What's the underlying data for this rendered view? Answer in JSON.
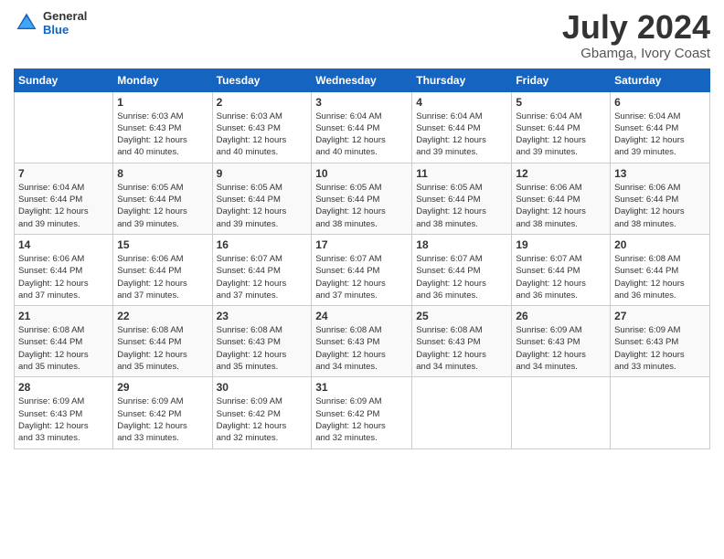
{
  "header": {
    "logo_line1": "General",
    "logo_line2": "Blue",
    "main_title": "July 2024",
    "subtitle": "Gbamga, Ivory Coast"
  },
  "calendar": {
    "days_of_week": [
      "Sunday",
      "Monday",
      "Tuesday",
      "Wednesday",
      "Thursday",
      "Friday",
      "Saturday"
    ],
    "weeks": [
      [
        {
          "day": "",
          "info": ""
        },
        {
          "day": "1",
          "info": "Sunrise: 6:03 AM\nSunset: 6:43 PM\nDaylight: 12 hours\nand 40 minutes."
        },
        {
          "day": "2",
          "info": "Sunrise: 6:03 AM\nSunset: 6:43 PM\nDaylight: 12 hours\nand 40 minutes."
        },
        {
          "day": "3",
          "info": "Sunrise: 6:04 AM\nSunset: 6:44 PM\nDaylight: 12 hours\nand 40 minutes."
        },
        {
          "day": "4",
          "info": "Sunrise: 6:04 AM\nSunset: 6:44 PM\nDaylight: 12 hours\nand 39 minutes."
        },
        {
          "day": "5",
          "info": "Sunrise: 6:04 AM\nSunset: 6:44 PM\nDaylight: 12 hours\nand 39 minutes."
        },
        {
          "day": "6",
          "info": "Sunrise: 6:04 AM\nSunset: 6:44 PM\nDaylight: 12 hours\nand 39 minutes."
        }
      ],
      [
        {
          "day": "7",
          "info": "Sunrise: 6:04 AM\nSunset: 6:44 PM\nDaylight: 12 hours\nand 39 minutes."
        },
        {
          "day": "8",
          "info": "Sunrise: 6:05 AM\nSunset: 6:44 PM\nDaylight: 12 hours\nand 39 minutes."
        },
        {
          "day": "9",
          "info": "Sunrise: 6:05 AM\nSunset: 6:44 PM\nDaylight: 12 hours\nand 39 minutes."
        },
        {
          "day": "10",
          "info": "Sunrise: 6:05 AM\nSunset: 6:44 PM\nDaylight: 12 hours\nand 38 minutes."
        },
        {
          "day": "11",
          "info": "Sunrise: 6:05 AM\nSunset: 6:44 PM\nDaylight: 12 hours\nand 38 minutes."
        },
        {
          "day": "12",
          "info": "Sunrise: 6:06 AM\nSunset: 6:44 PM\nDaylight: 12 hours\nand 38 minutes."
        },
        {
          "day": "13",
          "info": "Sunrise: 6:06 AM\nSunset: 6:44 PM\nDaylight: 12 hours\nand 38 minutes."
        }
      ],
      [
        {
          "day": "14",
          "info": "Sunrise: 6:06 AM\nSunset: 6:44 PM\nDaylight: 12 hours\nand 37 minutes."
        },
        {
          "day": "15",
          "info": "Sunrise: 6:06 AM\nSunset: 6:44 PM\nDaylight: 12 hours\nand 37 minutes."
        },
        {
          "day": "16",
          "info": "Sunrise: 6:07 AM\nSunset: 6:44 PM\nDaylight: 12 hours\nand 37 minutes."
        },
        {
          "day": "17",
          "info": "Sunrise: 6:07 AM\nSunset: 6:44 PM\nDaylight: 12 hours\nand 37 minutes."
        },
        {
          "day": "18",
          "info": "Sunrise: 6:07 AM\nSunset: 6:44 PM\nDaylight: 12 hours\nand 36 minutes."
        },
        {
          "day": "19",
          "info": "Sunrise: 6:07 AM\nSunset: 6:44 PM\nDaylight: 12 hours\nand 36 minutes."
        },
        {
          "day": "20",
          "info": "Sunrise: 6:08 AM\nSunset: 6:44 PM\nDaylight: 12 hours\nand 36 minutes."
        }
      ],
      [
        {
          "day": "21",
          "info": "Sunrise: 6:08 AM\nSunset: 6:44 PM\nDaylight: 12 hours\nand 35 minutes."
        },
        {
          "day": "22",
          "info": "Sunrise: 6:08 AM\nSunset: 6:44 PM\nDaylight: 12 hours\nand 35 minutes."
        },
        {
          "day": "23",
          "info": "Sunrise: 6:08 AM\nSunset: 6:43 PM\nDaylight: 12 hours\nand 35 minutes."
        },
        {
          "day": "24",
          "info": "Sunrise: 6:08 AM\nSunset: 6:43 PM\nDaylight: 12 hours\nand 34 minutes."
        },
        {
          "day": "25",
          "info": "Sunrise: 6:08 AM\nSunset: 6:43 PM\nDaylight: 12 hours\nand 34 minutes."
        },
        {
          "day": "26",
          "info": "Sunrise: 6:09 AM\nSunset: 6:43 PM\nDaylight: 12 hours\nand 34 minutes."
        },
        {
          "day": "27",
          "info": "Sunrise: 6:09 AM\nSunset: 6:43 PM\nDaylight: 12 hours\nand 33 minutes."
        }
      ],
      [
        {
          "day": "28",
          "info": "Sunrise: 6:09 AM\nSunset: 6:43 PM\nDaylight: 12 hours\nand 33 minutes."
        },
        {
          "day": "29",
          "info": "Sunrise: 6:09 AM\nSunset: 6:42 PM\nDaylight: 12 hours\nand 33 minutes."
        },
        {
          "day": "30",
          "info": "Sunrise: 6:09 AM\nSunset: 6:42 PM\nDaylight: 12 hours\nand 32 minutes."
        },
        {
          "day": "31",
          "info": "Sunrise: 6:09 AM\nSunset: 6:42 PM\nDaylight: 12 hours\nand 32 minutes."
        },
        {
          "day": "",
          "info": ""
        },
        {
          "day": "",
          "info": ""
        },
        {
          "day": "",
          "info": ""
        }
      ]
    ]
  }
}
